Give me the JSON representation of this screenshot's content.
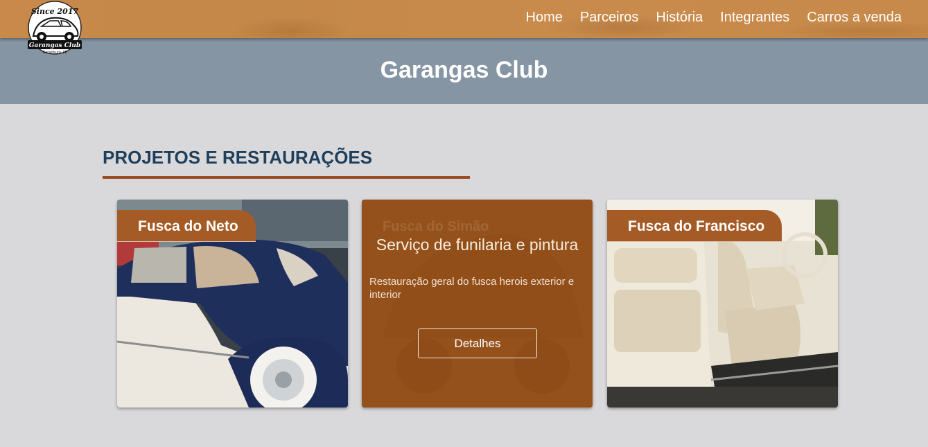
{
  "header": {
    "logo_top_text": "Since 2017",
    "logo_bottom_text": "Garangas Club",
    "logo_caption": "Garanhuns-PE",
    "nav": [
      "Home",
      "Parceiros",
      "História",
      "Integrantes",
      "Carros a venda"
    ]
  },
  "hero": {
    "title": "Garangas Club"
  },
  "section": {
    "title": "PROJETOS E RESTAURAÇÕES"
  },
  "cards": [
    {
      "title": "Fusca do Neto",
      "image": "blue-white-beetle-photo"
    },
    {
      "title": "Fusca do Simão",
      "heading": "Serviço de funilaria e pintura",
      "description": "Restauração geral do fusca herois exterior e interior",
      "button": "Detalhes",
      "image": "beetle-photo"
    },
    {
      "title": "Fusca do Francisco",
      "image": "cream-beetle-interior-photo"
    }
  ],
  "colors": {
    "navbar": "#c8894a",
    "title_band": "#8595a3",
    "section_title": "#1f3e5a",
    "accent": "#9a4d25",
    "card_tab": "#a55b25",
    "page_bg": "#d9d9dc"
  }
}
